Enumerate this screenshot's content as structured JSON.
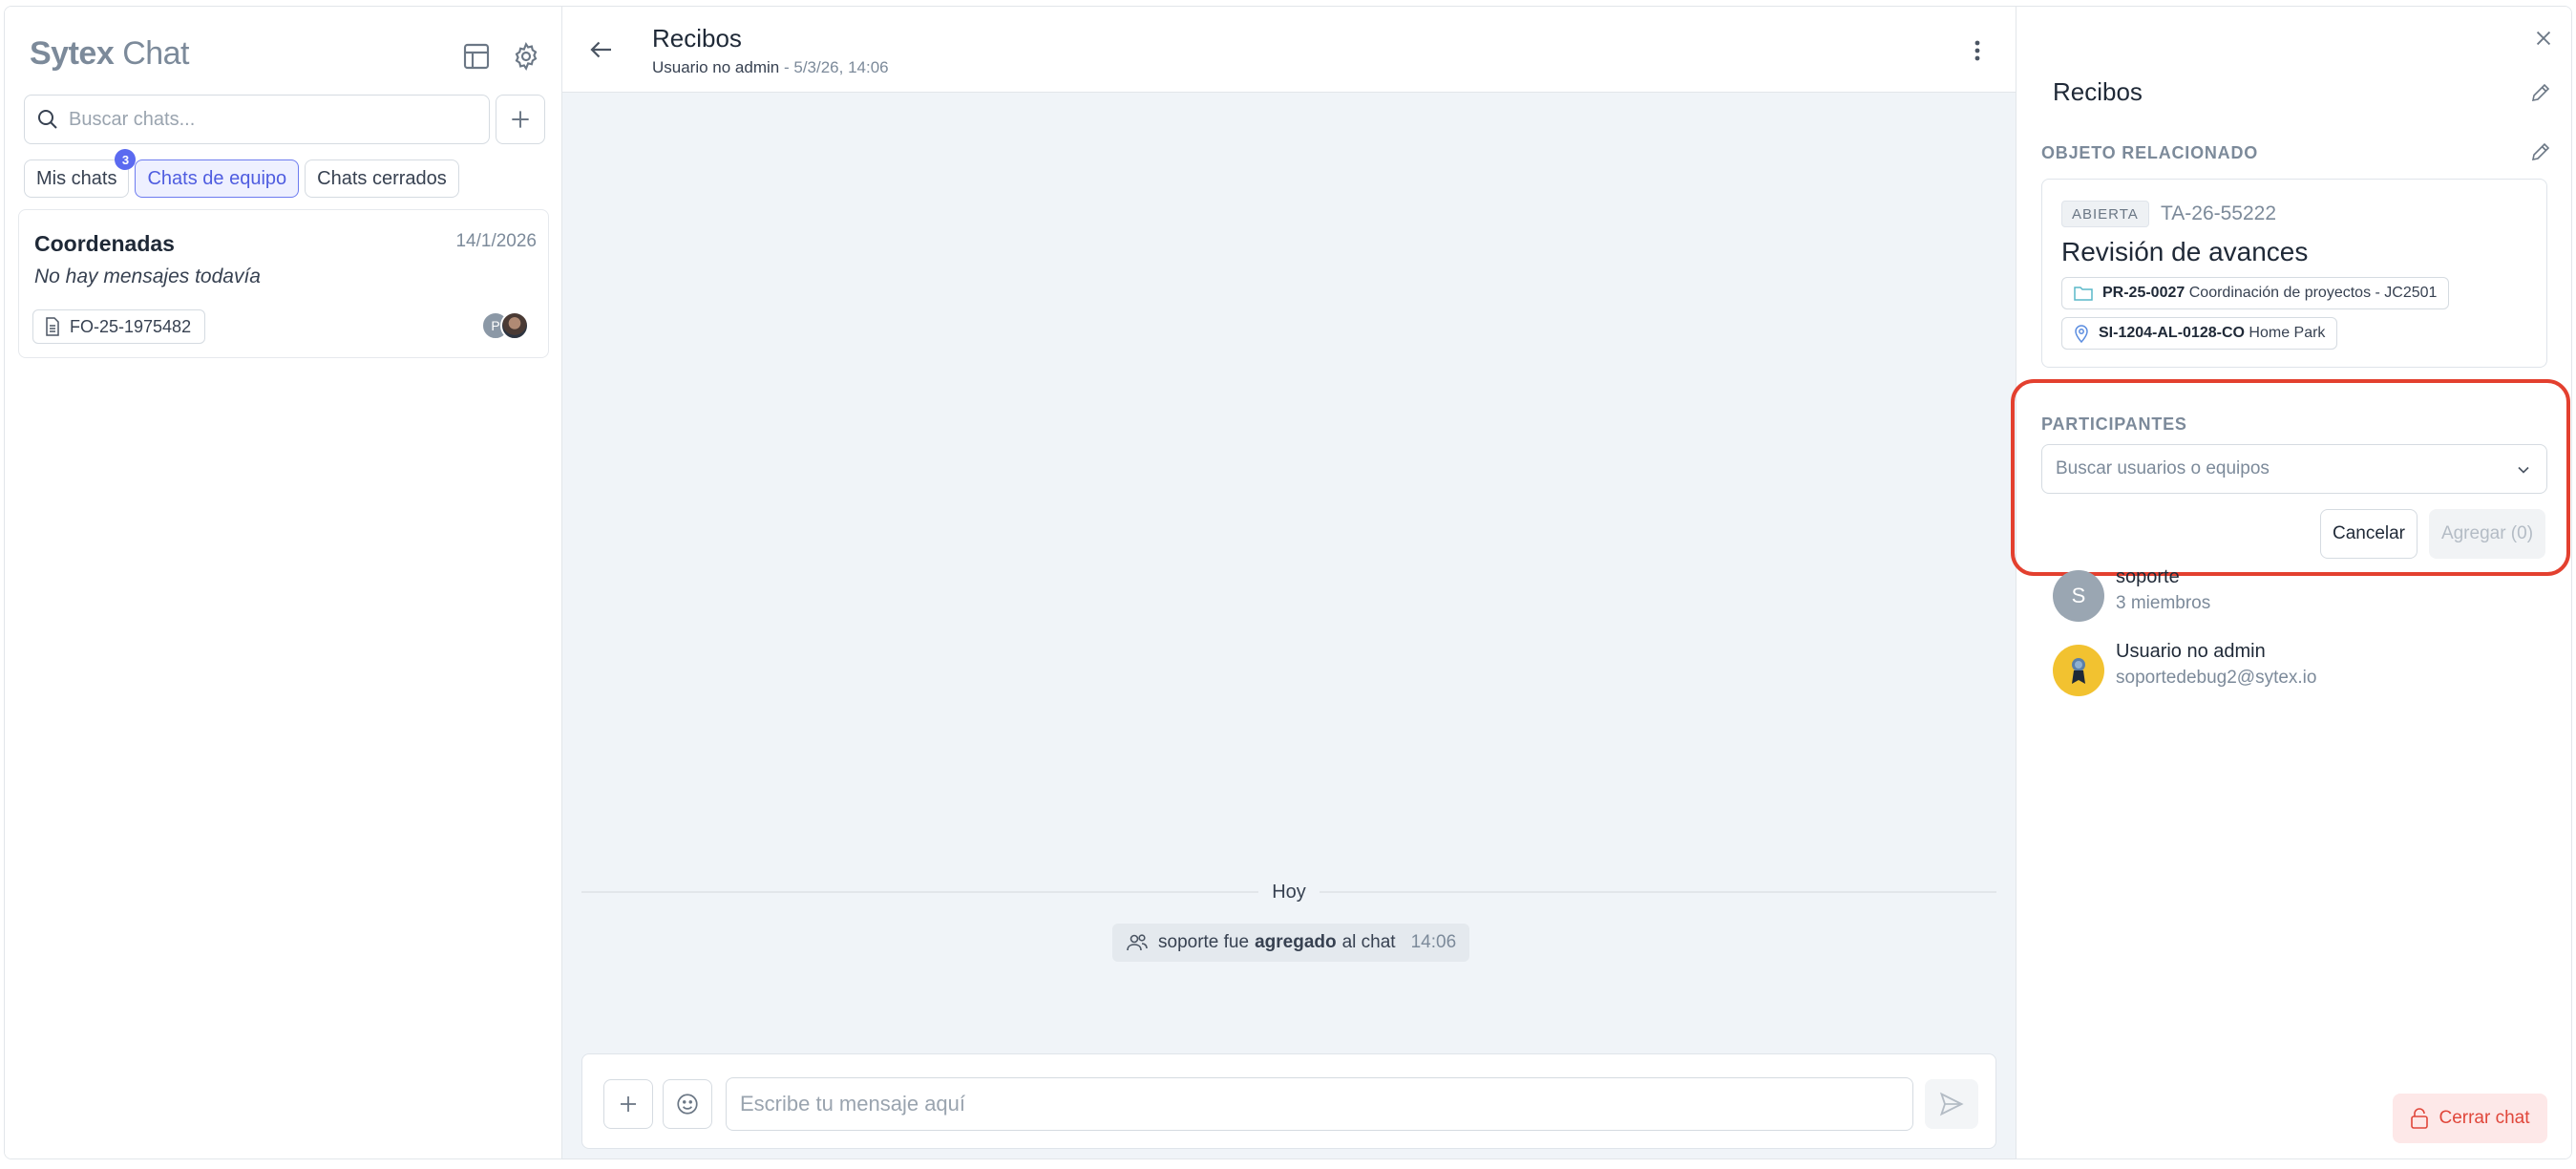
{
  "sidebar": {
    "logo_part1": "Sytex",
    "logo_part2": "Chat",
    "search_placeholder": "Buscar chats...",
    "tabs": [
      {
        "label": "Mis chats",
        "badge": "3"
      },
      {
        "label": "Chats de equipo"
      },
      {
        "label": "Chats cerrados"
      }
    ],
    "chats": [
      {
        "title": "Coordenadas",
        "date": "14/1/2026",
        "preview": "No hay mensajes todavía",
        "tag": "FO-25-1975482",
        "avatar_initial": "P"
      }
    ]
  },
  "center": {
    "title": "Recibos",
    "subtitle_user": "Usuario no admin",
    "subtitle_sep": " - ",
    "subtitle_time": "5/3/26, 14:06",
    "day_label": "Hoy",
    "system_message": {
      "prefix": "soporte fue",
      "bold": "agregado",
      "suffix": "al chat",
      "time": "14:06"
    },
    "composer_placeholder": "Escribe tu mensaje aquí"
  },
  "right_panel": {
    "title": "Recibos",
    "related_label": "OBJETO RELACIONADO",
    "related": {
      "status": "ABIERTA",
      "code": "TA-26-55222",
      "name": "Revisión de avances",
      "project_code": "PR-25-0027",
      "project_name": "Coordinación de proyectos - JC2501",
      "site_code": "SI-1204-AL-0128-CO",
      "site_name": "Home Park"
    },
    "participants_label": "PARTICIPANTES",
    "participants_placeholder": "Buscar usuarios o equipos",
    "cancel_label": "Cancelar",
    "add_label": "Agregar (0)",
    "members": [
      {
        "initial": "S",
        "name": "soporte",
        "sub": "3 miembros"
      },
      {
        "initial": "",
        "name": "Usuario no admin",
        "sub": "soportedebug2@sytex.io"
      }
    ],
    "close_chat_label": "Cerrar chat"
  },
  "colors": {
    "accent": "#5b6af0",
    "highlight": "#e3402f",
    "danger": "#e0463a"
  }
}
